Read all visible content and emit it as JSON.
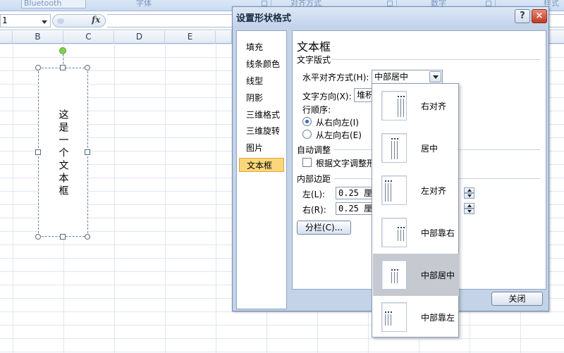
{
  "ribbon": {
    "group_bluetooth": "Bluetooth",
    "group_font": "字体",
    "group_alignment": "对齐方式",
    "group_number": "数字",
    "group_style": "样式"
  },
  "formula_bar": {
    "name_box_value": "1",
    "fx_label": "fx"
  },
  "sheet": {
    "columns": [
      "B",
      "C",
      "D",
      "E"
    ]
  },
  "shape": {
    "text": "这是一个文本框"
  },
  "dialog": {
    "title": "设置形状格式",
    "help_label": "?",
    "close_label": "×",
    "nav_items": [
      "填充",
      "线条颜色",
      "线型",
      "阴影",
      "三维格式",
      "三维旋转",
      "图片",
      "文本框"
    ],
    "selected_nav": "文本框",
    "section_heading": "文本框",
    "text_layout_group": "文字版式",
    "h_align_label": "水平对齐方式(H):",
    "h_align_value": "中部居中",
    "text_direction_label": "文字方向(X):",
    "text_direction_value": "堆积",
    "line_order_label": "行顺序:",
    "radio_rtl": "从右向左(I)",
    "radio_ltr": "从左向右(E)",
    "autofit_group": "自动调整",
    "autofit_checkbox": "根据文字调整形",
    "margins_group": "内部边距",
    "left_label": "左(L):",
    "left_value": "0.25 厘米",
    "right_label": "右(R):",
    "right_value": "0.25 厘米",
    "columns_button": "分栏(C)...",
    "close_button": "关闭"
  },
  "dropdown": {
    "options": [
      "右对齐",
      "居中",
      "左对齐",
      "中部靠右",
      "中部居中",
      "中部靠左"
    ],
    "selected": "中部居中"
  },
  "colors": {
    "selected_nav_bg": "#fbd77b",
    "dropdown_selected_bg": "#c6c9d0",
    "rotate_handle": "#7fd14f"
  }
}
